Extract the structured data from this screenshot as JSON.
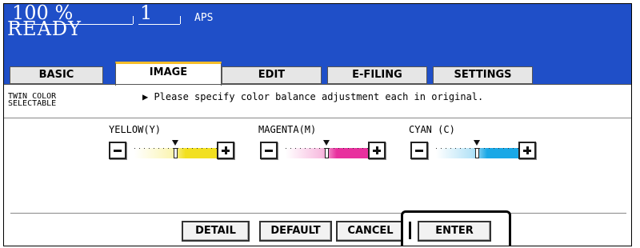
{
  "header": {
    "zoom": "100 %",
    "copies": "1",
    "paper": "APS",
    "status": "READY"
  },
  "tabs": [
    {
      "label": "BASIC",
      "active": false
    },
    {
      "label": "IMAGE",
      "active": true
    },
    {
      "label": "EDIT",
      "active": false
    },
    {
      "label": "E-FILING",
      "active": false
    },
    {
      "label": "SETTINGS",
      "active": false
    }
  ],
  "panel": {
    "mode_label_line1": "TWIN COLOR",
    "mode_label_line2": "SELECTABLE",
    "message": "▶ Please specify color balance adjustment each in original."
  },
  "adjusters": [
    {
      "label": "YELLOW(Y)",
      "color": "#f2e020",
      "level": 0.5
    },
    {
      "label": "MAGENTA(M)",
      "color": "#e8309e",
      "level": 0.5
    },
    {
      "label": "CYAN (C)",
      "color": "#1aa8e6",
      "level": 0.5
    }
  ],
  "buttons": {
    "detail": "DETAIL",
    "default": "DEFAULT",
    "cancel": "CANCEL",
    "enter": "ENTER"
  },
  "colors": {
    "header_bg": "#1f4fc8",
    "active_tab_accent": "#f5bd2a"
  }
}
